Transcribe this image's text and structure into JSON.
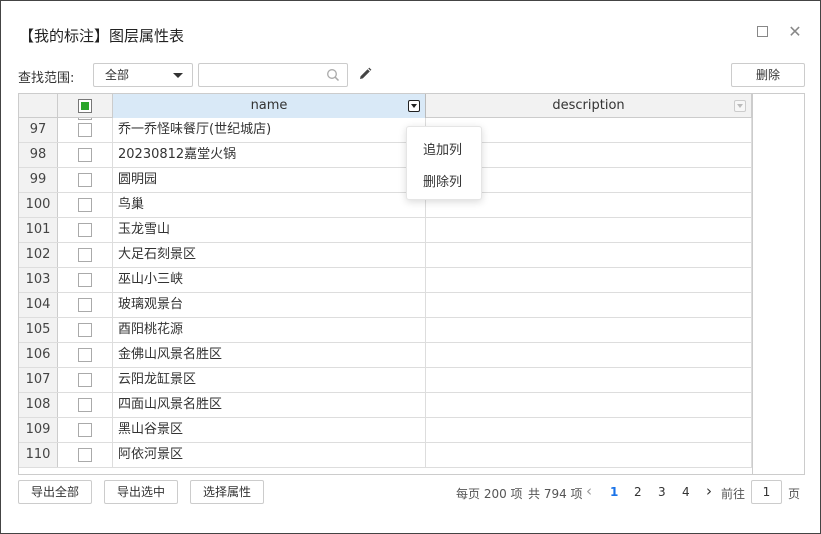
{
  "window": {
    "title": "【我的标注】图层属性表",
    "maximize_icon": "maximize-icon",
    "close_icon": "close-icon",
    "close_glyph": "✕"
  },
  "toolbar": {
    "scope_label": "查找范围:",
    "scope_value": "全部",
    "search_value": "",
    "search_placeholder": "",
    "delete_label": "删除"
  },
  "table": {
    "columns": [
      {
        "label": ""
      },
      {
        "label": ""
      },
      {
        "label": "name"
      },
      {
        "label": "description"
      }
    ],
    "header_checkbox": "partial",
    "rows": [
      {
        "num": "97",
        "name": "乔一乔怪味餐厅(世纪城店)",
        "description": ""
      },
      {
        "num": "98",
        "name": "20230812嘉堂火锅",
        "description": ""
      },
      {
        "num": "99",
        "name": "圆明园",
        "description": ""
      },
      {
        "num": "100",
        "name": "鸟巢",
        "description": ""
      },
      {
        "num": "101",
        "name": "玉龙雪山",
        "description": ""
      },
      {
        "num": "102",
        "name": "大足石刻景区",
        "description": ""
      },
      {
        "num": "103",
        "name": "巫山小三峡",
        "description": ""
      },
      {
        "num": "104",
        "name": "玻璃观景台",
        "description": ""
      },
      {
        "num": "105",
        "name": "酉阳桃花源",
        "description": ""
      },
      {
        "num": "106",
        "name": "金佛山风景名胜区",
        "description": ""
      },
      {
        "num": "107",
        "name": "云阳龙缸景区",
        "description": ""
      },
      {
        "num": "108",
        "name": "四面山风景名胜区",
        "description": ""
      },
      {
        "num": "109",
        "name": "黑山谷景区",
        "description": ""
      },
      {
        "num": "110",
        "name": "阿依河景区",
        "description": ""
      }
    ]
  },
  "column_menu": {
    "items": [
      "追加列",
      "删除列"
    ]
  },
  "footer": {
    "export_all": "导出全部",
    "export_selected": "导出选中",
    "select_attributes": "选择属性",
    "page_size_text": "每页 200 项",
    "total_text": "共 794 项",
    "prev": "‹",
    "pages": [
      "1",
      "2",
      "3",
      "4"
    ],
    "current_page": "1",
    "next": "›",
    "goto_label": "前往",
    "goto_value": "1",
    "goto_suffix": "页"
  },
  "colors": {
    "accent": "#1a73e8",
    "header_selected": "#d9e9f7",
    "checkbox_partial": "#2aa52a"
  }
}
